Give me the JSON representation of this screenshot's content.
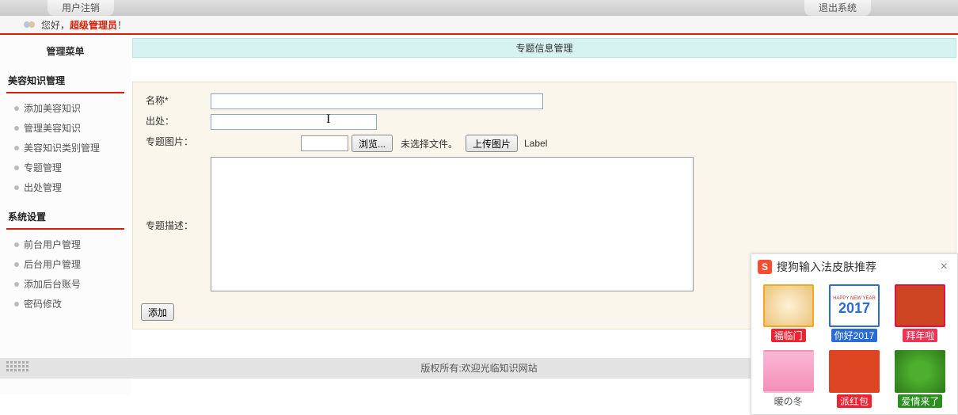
{
  "topTabs": {
    "left": "用户注销",
    "right": "退出系统"
  },
  "greeting": {
    "prefix": "您好，",
    "name": "超级管理员",
    "suffix": "！"
  },
  "sidebar": {
    "header": "管理菜单",
    "groups": [
      {
        "title": "美容知识管理",
        "items": [
          "添加美容知识",
          "管理美容知识",
          "美容知识类别管理",
          "专题管理",
          "出处管理"
        ]
      },
      {
        "title": "系统设置",
        "items": [
          "前台用户管理",
          "后台用户管理",
          "添加后台账号",
          "密码修改"
        ]
      }
    ]
  },
  "main": {
    "sectionTitle": "专题信息管理",
    "fields": {
      "nameLabel": "名称*",
      "sourceLabel": "出处：",
      "imageLabel": "专题图片：",
      "descLabel": "专题描述：",
      "nameValue": "",
      "sourceValue": "",
      "descValue": ""
    },
    "file": {
      "browseBtn": "浏览...",
      "noFile": "未选择文件。",
      "uploadBtn": "上传图片",
      "labelText": "Label"
    },
    "submitBtn": "添加"
  },
  "footer": "版权所有:欢迎光临知识网站",
  "sogou": {
    "title": "搜狗输入法皮肤推荐",
    "logo": "S",
    "skins": [
      {
        "name": "福临门",
        "capClass": "red"
      },
      {
        "name": "你好2017",
        "capClass": "blue"
      },
      {
        "name": "拜年啦",
        "capClass": "orange"
      },
      {
        "name": "暖の冬",
        "capClass": ""
      },
      {
        "name": "派红包",
        "capClass": "red"
      },
      {
        "name": "爱情来了",
        "capClass": "green"
      }
    ]
  }
}
